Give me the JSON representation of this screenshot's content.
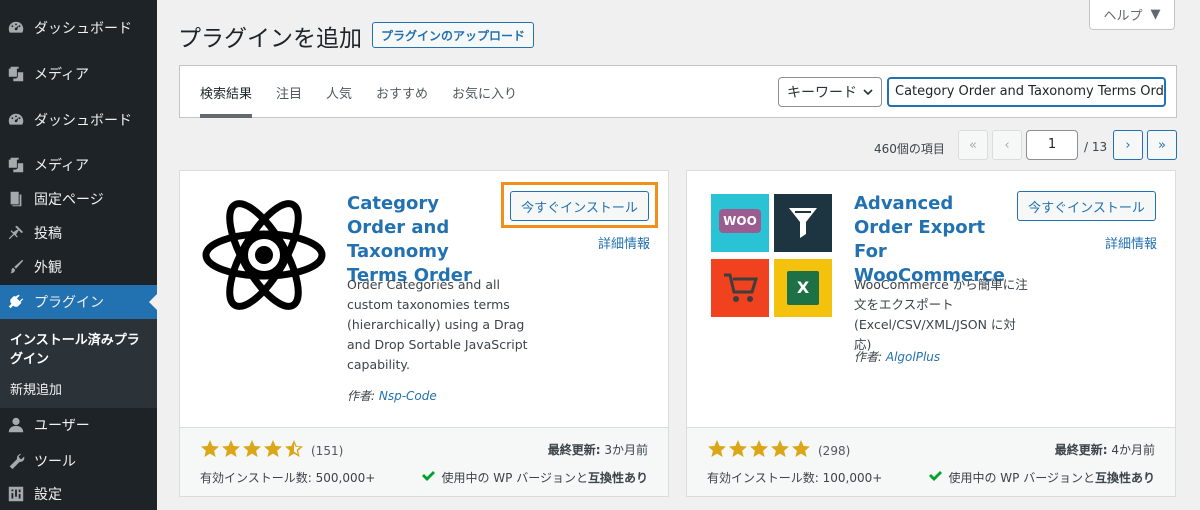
{
  "sidebar": {
    "items": [
      {
        "label": "ダッシュボード",
        "icon": "dashboard-icon"
      },
      {
        "label": "メディア",
        "icon": "media-icon"
      },
      {
        "label": "ダッシュボード",
        "icon": "dashboard-icon"
      },
      {
        "label": "メディア",
        "icon": "media-icon"
      },
      {
        "label": "固定ページ",
        "icon": "page-icon"
      },
      {
        "label": "投稿",
        "icon": "pin-icon"
      },
      {
        "label": "外観",
        "icon": "brush-icon"
      },
      {
        "label": "プラグイン",
        "icon": "plugin-icon"
      },
      {
        "label": "ユーザー",
        "icon": "user-icon"
      },
      {
        "label": "ツール",
        "icon": "wrench-icon"
      },
      {
        "label": "設定",
        "icon": "settings-icon"
      }
    ],
    "submenu": {
      "installed": "インストール済みプラグイン",
      "add_new": "新規追加"
    }
  },
  "header": {
    "title": "プラグインを追加",
    "upload_button": "プラグインのアップロード",
    "help": "ヘルプ"
  },
  "filter": {
    "tabs": [
      "検索結果",
      "注目",
      "人気",
      "おすすめ",
      "お気に入り"
    ],
    "select_value": "キーワード",
    "search_value": "Category Order and Taxonomy Terms Order"
  },
  "pagination": {
    "items_count": "460個の項目",
    "first": "«",
    "prev": "‹",
    "current_page": "1",
    "total": "/ 13",
    "next": "›",
    "last": "»"
  },
  "plugins": [
    {
      "name": "Category Order and Taxonomy Terms Order",
      "install_label": "今すぐインストール",
      "details_label": "詳細情報",
      "description": "Order Categories and all custom taxonomies terms (hierarchically) using a Drag and Drop Sortable JavaScript capability.",
      "author_prefix": "作者:",
      "author": "Nsp-Code",
      "rating": 4.5,
      "rating_count": "(151)",
      "last_updated_label": "最終更新:",
      "last_updated": "3か月前",
      "active_installs": "有効インストール数: 500,000+",
      "compat_text": "使用中の WP バージョンと",
      "compat_bold": "互換性あり"
    },
    {
      "name": "Advanced Order Export For WooCommerce",
      "install_label": "今すぐインストール",
      "details_label": "詳細情報",
      "description": "WooCommerce から簡単に注文をエクスポート (Excel/CSV/XML/JSON に対応)",
      "author_prefix": "作者:",
      "author": "AlgolPlus",
      "rating": 5,
      "rating_count": "(298)",
      "last_updated_label": "最終更新:",
      "last_updated": "4か月前",
      "active_installs": "有効インストール数: 100,000+",
      "compat_text": "使用中の WP バージョンと",
      "compat_bold": "互換性あり",
      "icon_tiles": [
        "WOO",
        "filter",
        "cart",
        "X"
      ]
    }
  ]
}
